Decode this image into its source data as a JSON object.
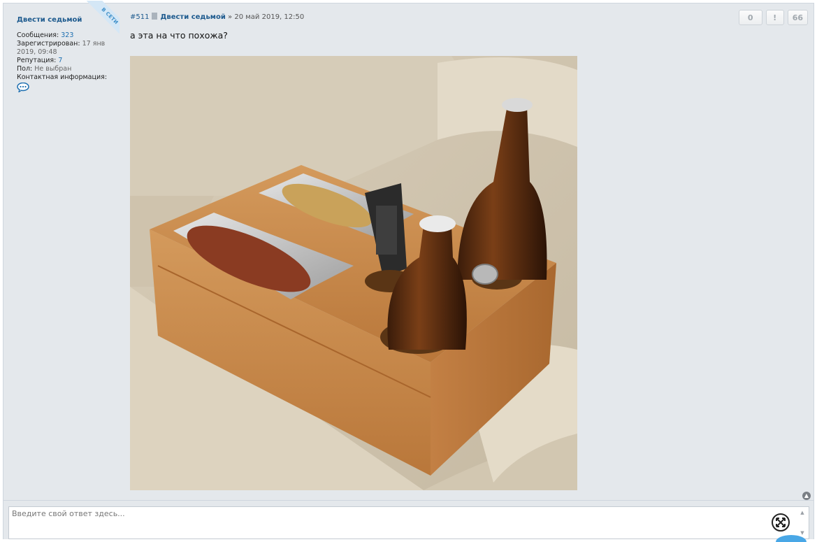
{
  "author": {
    "name": "Двести седьмой",
    "online_badge": "В СЕТИ",
    "posts_label": "Сообщения:",
    "posts_value": "323",
    "registered_label": "Зарегистрирован:",
    "registered_value": "17 янв 2019, 09:48",
    "reputation_label": "Репутация:",
    "reputation_value": "7",
    "gender_label": "Пол:",
    "gender_value": "Не выбран",
    "contact_label": "Контактная информация:"
  },
  "post": {
    "number": "#511",
    "username": "Двести седьмой",
    "separator": "»",
    "date": "20 май 2019, 12:50",
    "text": "а эта на что похожа?",
    "actions": {
      "vote_count": "0",
      "report_label": "!",
      "quote_label": "66"
    }
  },
  "reply": {
    "placeholder": "Введите свой ответ здесь..."
  },
  "icons": {
    "contact": "speech-bubble-icon",
    "post_type": "file-icon",
    "scroll_top": "chevron-up-icon",
    "expand": "expand-arrows-icon"
  },
  "colors": {
    "link": "#1d5a8e",
    "accent_blue": "#1d6fb1",
    "panel_bg": "#e4e8ec",
    "online_ribbon": "#d4e7f6"
  }
}
